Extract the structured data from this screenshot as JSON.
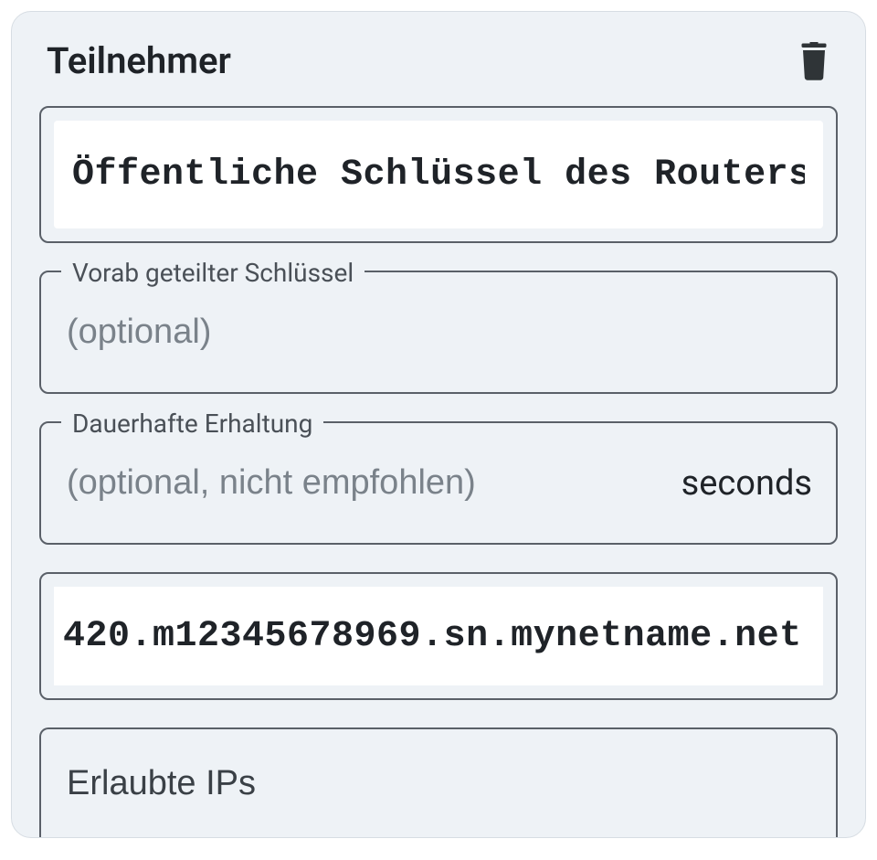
{
  "card": {
    "title": "Teilnehmer"
  },
  "fields": {
    "public_key": {
      "value": "Öffentliche Schlüssel des Routers"
    },
    "preshared_key": {
      "label": "Vorab geteilter Schlüssel",
      "placeholder": "(optional)",
      "value": ""
    },
    "keepalive": {
      "label": "Dauerhafte Erhaltung",
      "placeholder": "(optional, nicht empfohlen)",
      "value": "",
      "suffix": "seconds"
    },
    "endpoint": {
      "value": "420.m12345678969.sn.mynetname.net"
    },
    "allowed_ips": {
      "placeholder": "Erlaubte IPs",
      "value": ""
    }
  },
  "icons": {
    "trash": "trash-icon"
  }
}
